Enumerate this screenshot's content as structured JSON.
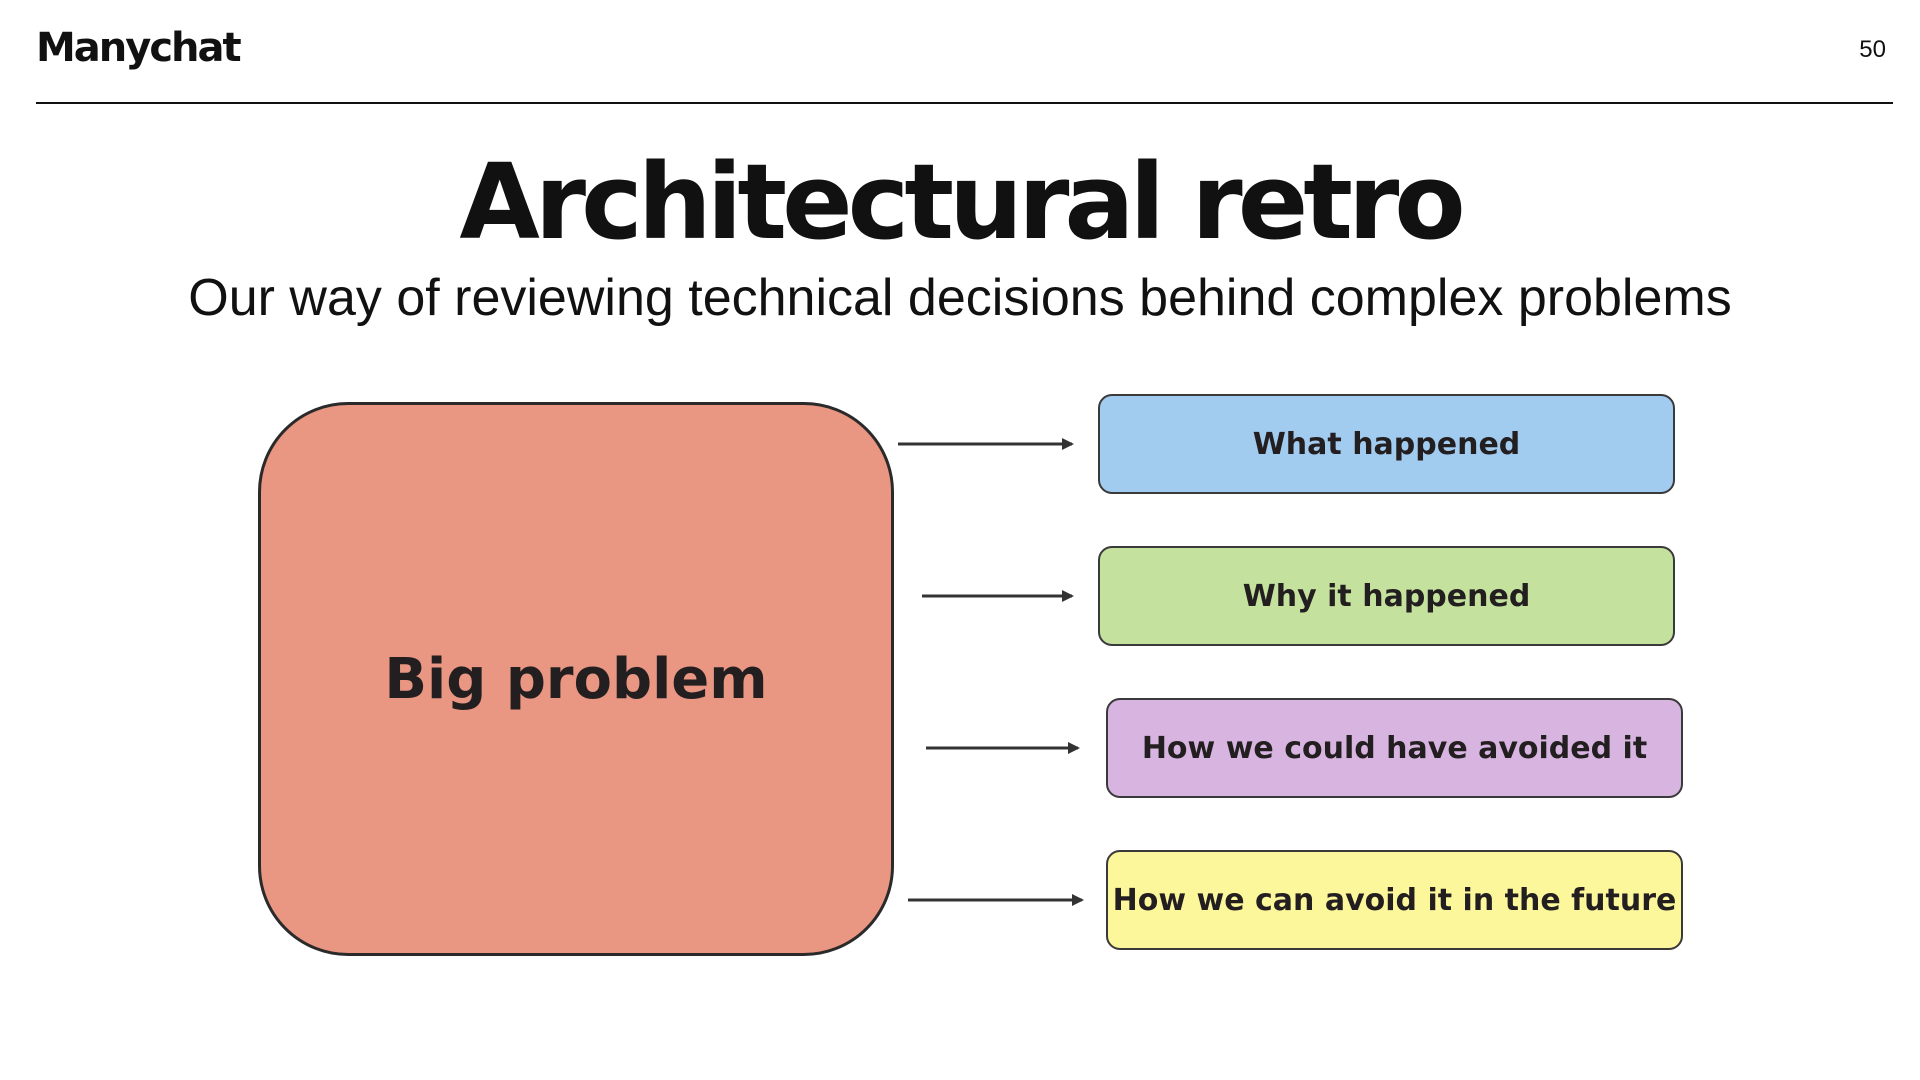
{
  "header": {
    "logo_text": "Manychat",
    "page_number": "50"
  },
  "slide": {
    "title": "Architectural retro",
    "subtitle": "Our way of reviewing technical decisions behind complex problems"
  },
  "diagram": {
    "source": {
      "label": "Big problem",
      "color": "#e99682"
    },
    "steps": [
      {
        "label": "What happened",
        "color": "#a2cbf0"
      },
      {
        "label": "Why it happened",
        "color": "#c4e29e"
      },
      {
        "label": "How we could have avoided it",
        "color": "#d8b5e1"
      },
      {
        "label": "How we can avoid it in the future",
        "color": "#fcf79b"
      }
    ],
    "arrow_color": "#333333"
  }
}
